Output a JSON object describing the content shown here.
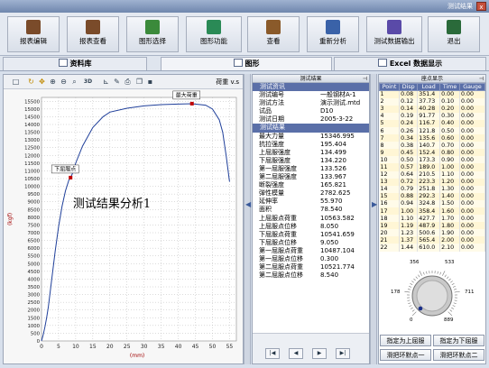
{
  "window": {
    "title": "测试结果",
    "close_glyph": "x"
  },
  "toolbar": {
    "buttons": [
      {
        "label": "报表编辑",
        "icon": "report-edit-icon",
        "color": "#7a4b2a"
      },
      {
        "label": "报表查看",
        "icon": "report-view-icon",
        "color": "#7a4b2a"
      },
      {
        "label": "图形选择",
        "icon": "graph-select-icon",
        "color": "#3b8a3b"
      },
      {
        "label": "图形功能",
        "icon": "graph-function-icon",
        "color": "#2a8a56"
      },
      {
        "label": "查看",
        "icon": "view-icon",
        "color": "#8a5a2a"
      },
      {
        "label": "重新分析",
        "icon": "reanalyze-icon",
        "color": "#3a62a8"
      },
      {
        "label": "测试数据输出",
        "icon": "data-export-icon",
        "color": "#5a4aa8"
      },
      {
        "label": "退出",
        "icon": "exit-icon",
        "color": "#2a6a3a"
      }
    ]
  },
  "tabs": [
    {
      "label": "资料库",
      "active": false
    },
    {
      "label": "图形",
      "active": true
    },
    {
      "label": "Excel 数据显示",
      "active": false
    }
  ],
  "chart_toolbar": {
    "3d_label": "3D",
    "right_text": "荷重 v.s"
  },
  "chart_data": {
    "type": "line",
    "title": "",
    "xlabel": "(mm)",
    "ylabel": "(kgf)",
    "x_ticks": [
      0,
      5,
      10,
      15,
      20,
      25,
      30,
      35,
      40,
      45,
      50,
      55
    ],
    "y_ticks": [
      0,
      500,
      1000,
      1500,
      2000,
      2500,
      3000,
      3500,
      4000,
      4500,
      5000,
      5500,
      6000,
      6500,
      7000,
      7500,
      8000,
      8500,
      9000,
      9500,
      10000,
      10500,
      11000,
      11500,
      12000,
      12500,
      13000,
      13500,
      14000,
      14500,
      15000,
      15500
    ],
    "xlim": [
      0,
      57
    ],
    "ylim": [
      0,
      15750
    ],
    "series": [
      {
        "x": [
          0,
          0.5,
          1,
          1.5,
          2,
          3,
          4,
          5,
          6,
          7,
          8,
          8.5,
          9,
          10,
          12,
          15,
          18,
          20,
          25,
          30,
          35,
          40,
          44,
          48,
          50,
          52,
          53,
          54,
          55
        ],
        "y": [
          0,
          400,
          900,
          1500,
          2200,
          4000,
          5800,
          7400,
          8700,
          9700,
          10400,
          10560,
          10800,
          11500,
          12600,
          13800,
          14500,
          14800,
          15050,
          15200,
          15280,
          15320,
          15340,
          15250,
          15000,
          14300,
          13500,
          12000,
          10300
        ]
      }
    ],
    "annotations": [
      {
        "text": "下屈服点",
        "x": 8.5,
        "y": 10563
      },
      {
        "text": "最大荷重",
        "x": 44,
        "y": 15347
      }
    ],
    "overlay_text": "测试结果分析1",
    "grid": true
  },
  "results": {
    "header": "测试结果",
    "rows": [
      {
        "k": "测试资讯",
        "v": "",
        "section": true
      },
      {
        "k": "测试编号",
        "v": "一般钢材A-1"
      },
      {
        "k": "测试方法",
        "v": "演示测试.mtd"
      },
      {
        "k": "试品",
        "v": "D10"
      },
      {
        "k": "测试日期",
        "v": "2005-3-22"
      },
      {
        "k": "测试结果",
        "v": "",
        "section": true
      },
      {
        "k": "最大力量",
        "v": "15346.995"
      },
      {
        "k": "抗拉强度",
        "v": "195.404"
      },
      {
        "k": "上屈服强度",
        "v": "134.499"
      },
      {
        "k": "下屈服强度",
        "v": "134.220"
      },
      {
        "k": "第一屈服强度",
        "v": "133.526"
      },
      {
        "k": "第二屈服强度",
        "v": "133.967"
      },
      {
        "k": "断裂强度",
        "v": "165.821"
      },
      {
        "k": "弹性模量",
        "v": "2782.625"
      },
      {
        "k": "延伸率",
        "v": "55.970"
      },
      {
        "k": "面积",
        "v": "78.540"
      },
      {
        "k": "上屈服点荷重",
        "v": "10563.582"
      },
      {
        "k": "上屈服点位移",
        "v": "8.050"
      },
      {
        "k": "下屈服点荷重",
        "v": "10541.659"
      },
      {
        "k": "下屈服点位移",
        "v": "9.050"
      },
      {
        "k": "第一屈服点荷重",
        "v": "10487.104"
      },
      {
        "k": "第一屈服点位移",
        "v": "0.300"
      },
      {
        "k": "第二屈服点荷重",
        "v": "10521.774"
      },
      {
        "k": "第二屈服点位移",
        "v": "8.540"
      }
    ],
    "nav": [
      "|◀",
      "◀",
      "▶",
      "▶|"
    ]
  },
  "points": {
    "header": "座点显示",
    "columns": [
      "Point",
      "Disp",
      "Load",
      "Time",
      "Gauge"
    ],
    "rows": [
      [
        "1",
        "0.08",
        "351.4",
        "0.00",
        "0.00"
      ],
      [
        "2",
        "0.12",
        "37.73",
        "0.10",
        "0.00"
      ],
      [
        "3",
        "0.14",
        "40.28",
        "0.20",
        "0.00"
      ],
      [
        "4",
        "0.19",
        "91.77",
        "0.30",
        "0.00"
      ],
      [
        "5",
        "0.24",
        "116.7",
        "0.40",
        "0.00"
      ],
      [
        "6",
        "0.26",
        "121.8",
        "0.50",
        "0.00"
      ],
      [
        "7",
        "0.34",
        "135.6",
        "0.60",
        "0.00"
      ],
      [
        "8",
        "0.38",
        "140.7",
        "0.70",
        "0.00"
      ],
      [
        "9",
        "0.45",
        "152.4",
        "0.80",
        "0.00"
      ],
      [
        "10",
        "0.50",
        "173.3",
        "0.90",
        "0.00"
      ],
      [
        "11",
        "0.57",
        "189.0",
        "1.00",
        "0.00"
      ],
      [
        "12",
        "0.64",
        "210.5",
        "1.10",
        "0.00"
      ],
      [
        "13",
        "0.72",
        "223.3",
        "1.20",
        "0.00"
      ],
      [
        "14",
        "0.79",
        "251.8",
        "1.30",
        "0.00"
      ],
      [
        "15",
        "0.88",
        "292.3",
        "1.40",
        "0.00"
      ],
      [
        "16",
        "0.94",
        "324.8",
        "1.50",
        "0.00"
      ],
      [
        "17",
        "1.00",
        "358.4",
        "1.60",
        "0.00"
      ],
      [
        "18",
        "1.10",
        "427.7",
        "1.70",
        "0.00"
      ],
      [
        "19",
        "1.19",
        "487.9",
        "1.80",
        "0.00"
      ],
      [
        "20",
        "1.23",
        "500.6",
        "1.90",
        "0.00"
      ],
      [
        "21",
        "1.37",
        "565.4",
        "2.00",
        "0.00"
      ],
      [
        "22",
        "1.44",
        "610.0",
        "2.10",
        "0.00"
      ]
    ]
  },
  "knob": {
    "labels": {
      "top_left": "356",
      "top_right": "533",
      "left": "178",
      "right": "711",
      "bottom_left": "0",
      "bottom_right": "889"
    },
    "value": 0
  },
  "point_buttons": {
    "set_upper": "指定为上屈服",
    "set_lower": "指定为下屈服",
    "slide_first": "滑把环默点一",
    "slide_second": "滑把环默点二"
  }
}
